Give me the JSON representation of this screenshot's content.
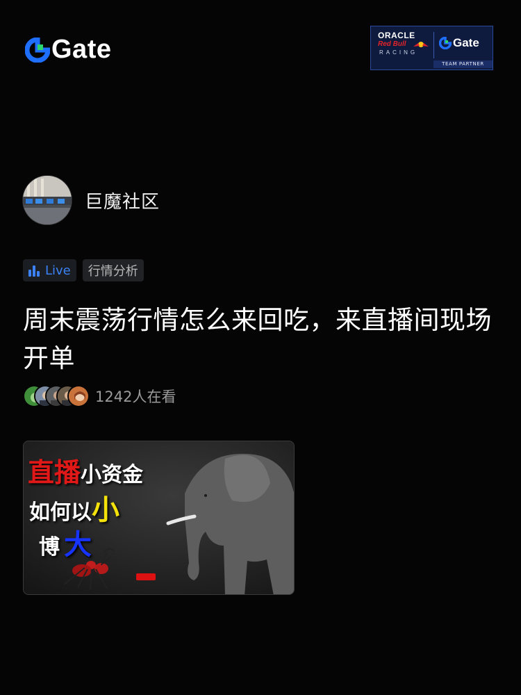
{
  "header": {
    "brand_name": "Gate",
    "partner": {
      "oracle": "ORACLE",
      "redbull": "Red Bull",
      "racing": "RACING",
      "gate": "Gate",
      "caption": "TEAM PARTNER"
    }
  },
  "author": {
    "name": "巨魔社区"
  },
  "tags": [
    {
      "label": "Live",
      "icon": "bar-chart-icon",
      "color": "#3b82f6"
    },
    {
      "label": "行情分析"
    }
  ],
  "post": {
    "title": "周末震荡行情怎么来回吃，来直播间现场开单",
    "viewers_text": "1242人在看"
  },
  "thumbnail": {
    "line1_red": "直播",
    "line1_white": "小资金",
    "line2_white": "如何以",
    "line2_yellow": "小",
    "line3_white": "博",
    "line3_blue": "大"
  },
  "colors": {
    "background": "#050505",
    "accent_blue": "#3b82f6",
    "gate_green": "#2bd46d",
    "gate_blue": "#1f6fff"
  }
}
